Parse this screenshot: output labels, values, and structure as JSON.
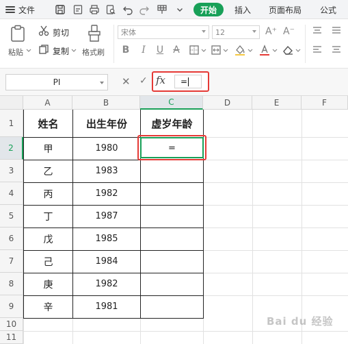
{
  "menubar": {
    "file_label": "文件",
    "tabs": [
      {
        "label": "开始",
        "active": true
      },
      {
        "label": "插入",
        "active": false
      },
      {
        "label": "页面布局",
        "active": false
      },
      {
        "label": "公式",
        "active": false
      }
    ],
    "quick_access_icons": [
      "save-icon",
      "export-icon",
      "print-icon",
      "print-preview-icon",
      "undo-icon",
      "redo-icon",
      "format-painter-small-icon",
      "more-dropdown-icon"
    ],
    "accent_color": "#18a058"
  },
  "ribbon": {
    "paste_label": "粘贴",
    "cut_label": "剪切",
    "copy_label": "复制",
    "format_painter_label": "格式刷",
    "font_name": "宋体",
    "font_size": "12",
    "grow_font": "A⁺",
    "shrink_font": "A⁻",
    "bold": "B",
    "italic": "I",
    "underline": "U",
    "strike": "A"
  },
  "formula_bar": {
    "name_box": "PI",
    "cancel_glyph": "✕",
    "confirm_glyph": "✓",
    "fx_label": "fx",
    "formula_value": "=",
    "highlight_color": "#e53935"
  },
  "sheet": {
    "columns": [
      "A",
      "B",
      "C",
      "D",
      "E",
      "F"
    ],
    "rows": [
      "1",
      "2",
      "3",
      "4",
      "5",
      "6",
      "7",
      "8",
      "9",
      "10",
      "11"
    ],
    "active_column": "C",
    "active_row": "2",
    "header": [
      "姓名",
      "出生年份",
      "虚岁年龄"
    ],
    "data": [
      {
        "name": "甲",
        "year": "1980",
        "age": "="
      },
      {
        "name": "乙",
        "year": "1983",
        "age": ""
      },
      {
        "name": "丙",
        "year": "1982",
        "age": ""
      },
      {
        "name": "丁",
        "year": "1987",
        "age": ""
      },
      {
        "name": "戊",
        "year": "1985",
        "age": ""
      },
      {
        "name": "己",
        "year": "1984",
        "age": ""
      },
      {
        "name": "庚",
        "year": "1982",
        "age": ""
      },
      {
        "name": "辛",
        "year": "1981",
        "age": ""
      }
    ]
  },
  "watermark": "Bai du 经验"
}
